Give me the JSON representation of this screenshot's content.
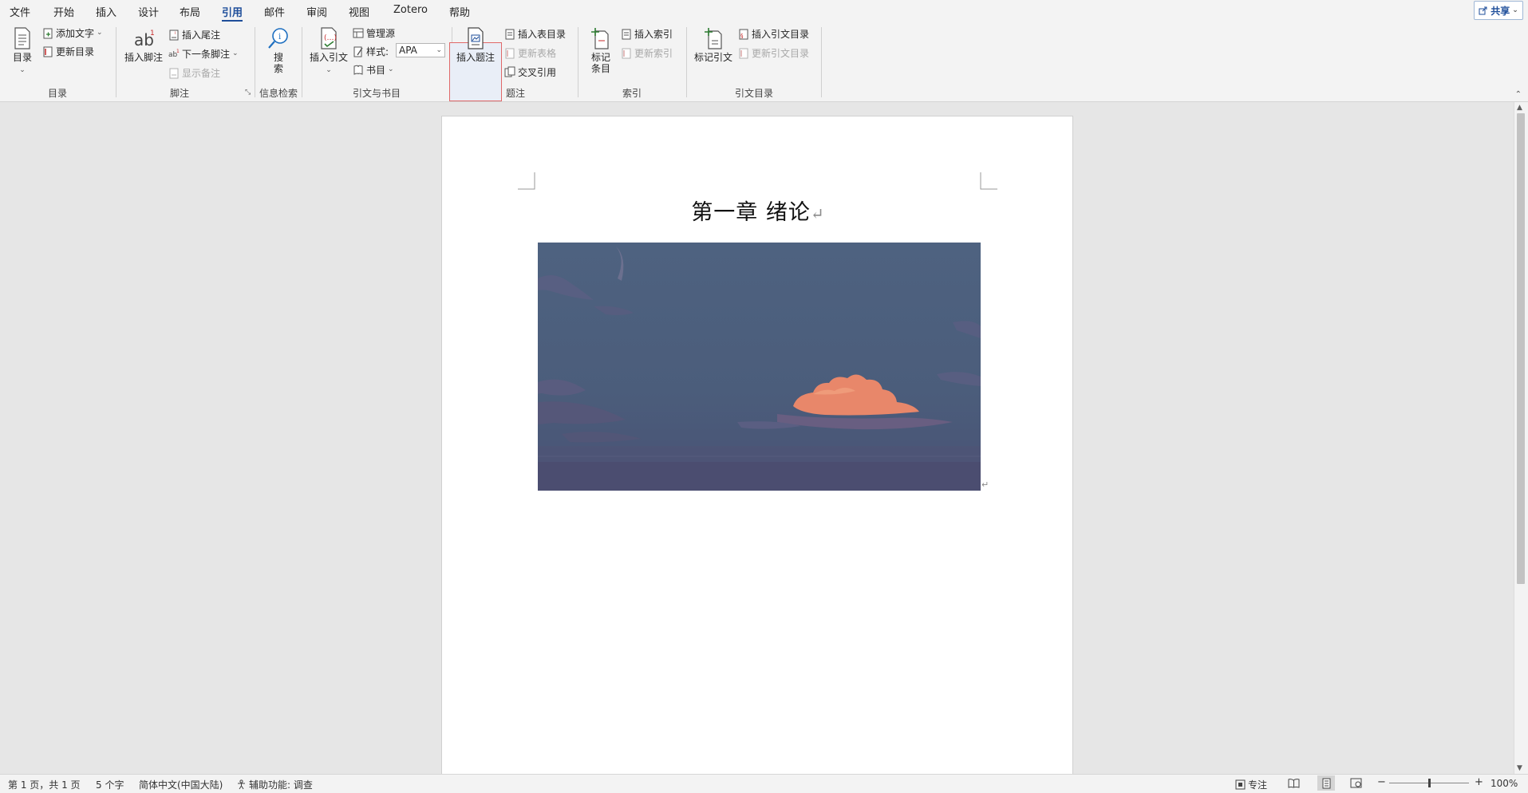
{
  "menu": {
    "tabs": [
      "文件",
      "开始",
      "插入",
      "设计",
      "布局",
      "引用",
      "邮件",
      "审阅",
      "视图",
      "Zotero",
      "帮助"
    ],
    "active_index": 5,
    "share_label": "共享"
  },
  "ribbon": {
    "toc": {
      "toc_label": "目录",
      "add_text_label": "添加文字",
      "update_toc_label": "更新目录",
      "group_label": "目录"
    },
    "footnotes": {
      "insert_footnote_label": "插入脚注",
      "insert_endnote_label": "插入尾注",
      "next_footnote_label": "下一条脚注",
      "show_notes_label": "显示备注",
      "group_label": "脚注"
    },
    "research": {
      "search_label_1": "搜",
      "search_label_2": "索",
      "group_label": "信息检索"
    },
    "citations": {
      "insert_citation_label": "插入引文",
      "manage_sources_label": "管理源",
      "style_label": "样式:",
      "style_value": "APA",
      "bibliography_label": "书目",
      "group_label": "引文与书目"
    },
    "captions": {
      "insert_caption_label": "插入题注",
      "insert_table_of_figures_label": "插入表目录",
      "update_table_label": "更新表格",
      "cross_reference_label": "交叉引用",
      "group_label": "题注"
    },
    "index": {
      "mark_entry_label_1": "标记",
      "mark_entry_label_2": "条目",
      "insert_index_label": "插入索引",
      "update_index_label": "更新索引",
      "group_label": "索引"
    },
    "toa": {
      "mark_citation_label": "标记引文",
      "insert_toa_label": "插入引文目录",
      "update_toa_label": "更新引文目录",
      "group_label": "引文目录"
    }
  },
  "document": {
    "heading": "第一章   绪论",
    "paragraph_mark": "↵"
  },
  "status": {
    "page_info": "第 1 页，共 1 页",
    "word_count": "5 个字",
    "language": "简体中文(中国大陆)",
    "accessibility": "辅助功能: 调查",
    "focus_label": "专注",
    "zoom_minus": "−",
    "zoom_plus": "+",
    "zoom_level": "100%",
    "zoom_fraction": 0.5
  },
  "colors": {
    "accent": "#1e4e9a",
    "highlight_border": "#e06868",
    "sky": "#4d5f7c",
    "cloud": "#e8876a"
  }
}
